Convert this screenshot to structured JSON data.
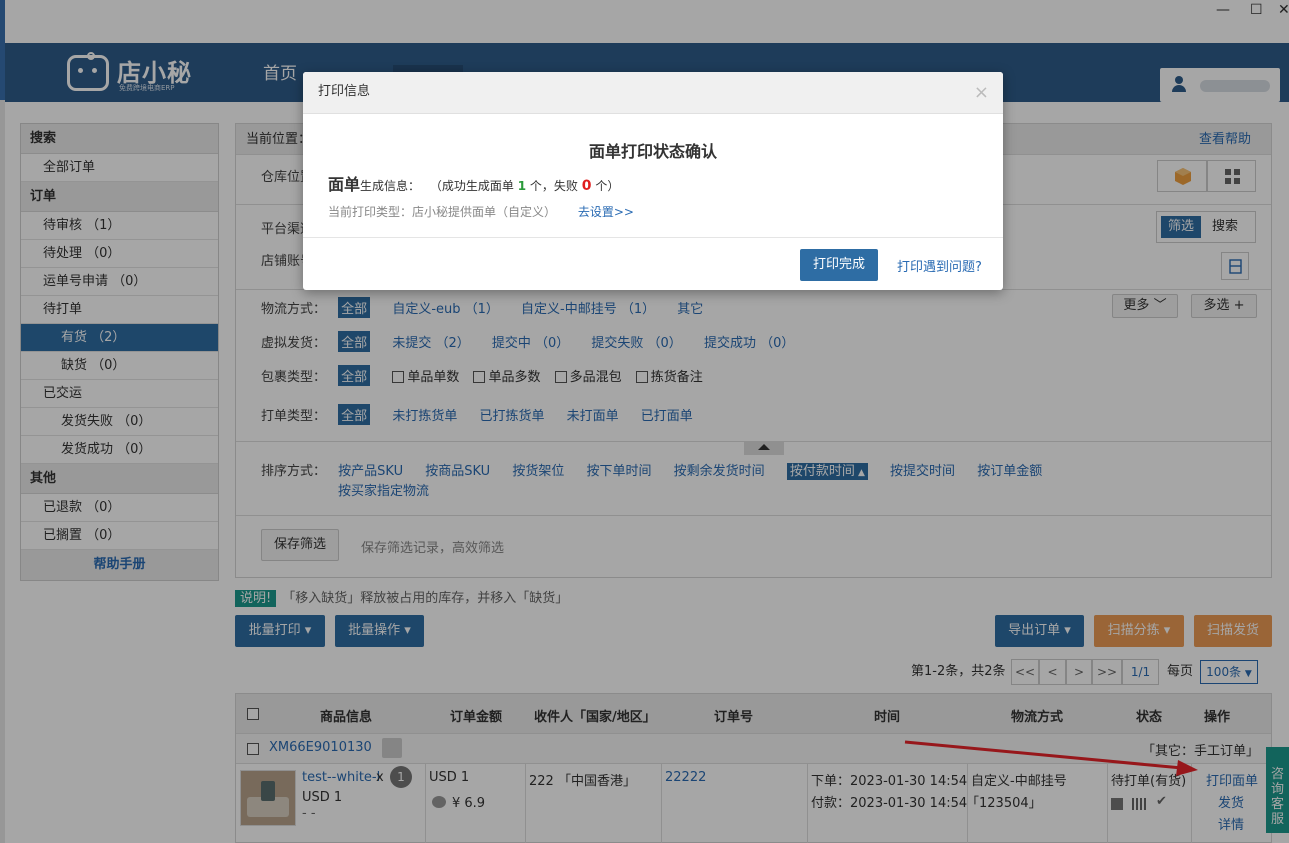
{
  "app": {
    "logo_text": "店小秘",
    "logo_sub": "免费跨境电商ERP",
    "nav_home": "首页"
  },
  "sidebar": {
    "search_head": "搜索",
    "all_orders": "全部订单",
    "order_head": "订单",
    "items": [
      {
        "label": "待审核 （1）"
      },
      {
        "label": "待处理 （0）"
      },
      {
        "label": "运单号申请 （0）"
      },
      {
        "label": "待打单"
      },
      {
        "label": "有货 （2）"
      },
      {
        "label": "缺货 （0）"
      },
      {
        "label": "已交运"
      },
      {
        "label": "发货失败 （0）"
      },
      {
        "label": "发货成功 （0）"
      }
    ],
    "other_head": "其他",
    "others": [
      {
        "label": "已退款 （0）"
      },
      {
        "label": "已搁置 （0）"
      }
    ],
    "help": "帮助手册"
  },
  "filters": {
    "breadcrumb": "当前位置：",
    "help_link": "查看帮助",
    "warehouse_label": "仓库位置",
    "platform_label": "平台渠道",
    "shop_label": "店铺账号",
    "btn_filter": "筛选",
    "btn_search": "搜索",
    "logistics": {
      "label": "物流方式：",
      "all": "全部",
      "options": [
        "自定义-eub （1）",
        "自定义-中邮挂号 （1）",
        "其它"
      ]
    },
    "more": "更多",
    "multi": "多选 +",
    "virtual": {
      "label": "虚拟发货：",
      "all": "全部",
      "options": [
        "未提交 （2）",
        "提交中 （0）",
        "提交失败 （0）",
        "提交成功 （0）"
      ]
    },
    "package": {
      "label": "包裹类型：",
      "all": "全部",
      "options": [
        "单品单数",
        "单品多数",
        "多品混包",
        "拣货备注"
      ]
    },
    "print_type": {
      "label": "打单类型：",
      "all": "全部",
      "options": [
        "未打拣货单",
        "已打拣货单",
        "未打面单",
        "已打面单"
      ]
    },
    "sort": {
      "label": "排序方式：",
      "options": [
        "按产品SKU",
        "按商品SKU",
        "按货架位",
        "按下单时间",
        "按剩余发货时间",
        "按付款时间",
        "按提交时间",
        "按订单金额"
      ],
      "active": "按付款时间",
      "second_line": "按买家指定物流"
    },
    "save_btn": "保存筛选",
    "save_hint": "保存筛选记录，高效筛选"
  },
  "notice": {
    "tip": "说明!",
    "text": "「移入缺货」释放被占用的库存，并移入「缺货」"
  },
  "actions": {
    "batch_print": "批量打印",
    "batch_ops": "批量操作",
    "export": "导出订单",
    "scan_sort": "扫描分拣",
    "scan_ship": "扫描发货"
  },
  "pager": {
    "summary": "第1-2条，共2条",
    "first": "<<",
    "prev": "<",
    "next": ">",
    "last": ">>",
    "page": "1/1",
    "per_page_label": "每页",
    "per_page": "100条"
  },
  "table": {
    "headers": [
      "商品信息",
      "订单金额",
      "收件人「国家/地区」",
      "订单号",
      "时间",
      "物流方式",
      "状态",
      "操作"
    ],
    "group_order_id": "XM66E9010130",
    "group_tag": "「其它：手工订单」",
    "row": {
      "product_name": "test--white-l",
      "qty_x": "x",
      "qty": "1",
      "product_price": "USD 1",
      "product_dash": "- -",
      "amount": "USD 1",
      "cost": "¥ 6.9",
      "recipient": "222 「中国香港」",
      "order_no": "22222",
      "order_time": "下单：2023-01-30 14:54",
      "pay_time": "付款：2023-01-30 14:54",
      "logistics": "自定义-中邮挂号",
      "tracking": "「123504」",
      "status": "待打单(有货)",
      "op_print": "打印面单",
      "op_ship": "发货",
      "op_detail": "详情"
    }
  },
  "modal": {
    "header": "打印信息",
    "close": "×",
    "title": "面单打印状态确认",
    "label_big": "面单",
    "label_gen": "生成信息：",
    "result_prefix": "（成功生成面单",
    "success_count": "1",
    "result_mid": "个，失败",
    "fail_count": "0",
    "result_suffix": "个）",
    "type_text": "当前打印类型：店小秘提供面单（自定义）",
    "set_link": "去设置>>",
    "done_btn": "打印完成",
    "problem_link": "打印遇到问题?"
  },
  "chat": {
    "label": "咨询客服"
  },
  "window": {
    "minimize": "—",
    "maximize": "☐",
    "close": "✕"
  }
}
